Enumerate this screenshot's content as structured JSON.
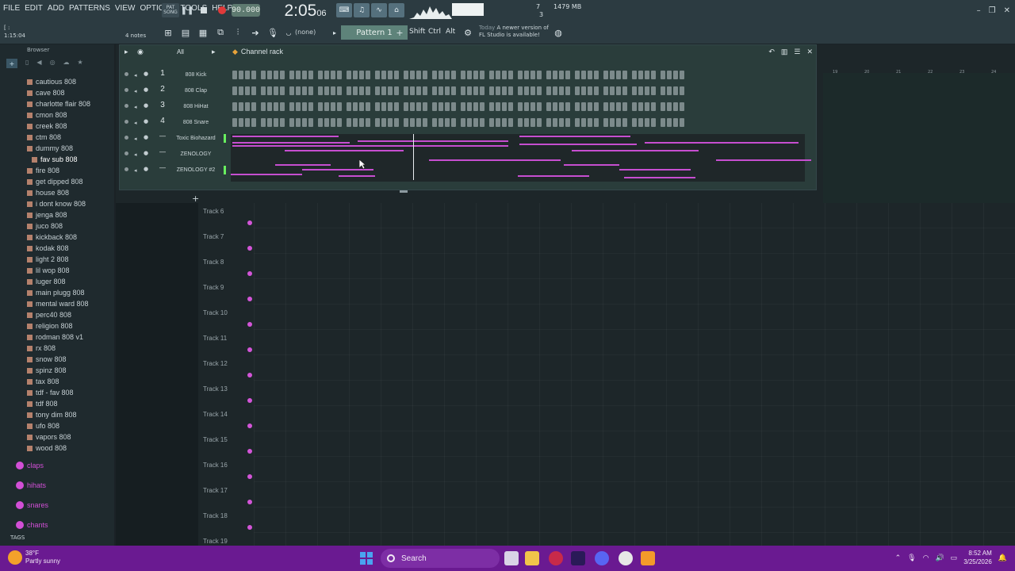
{
  "menu": [
    "FILE",
    "EDIT",
    "ADD",
    "PATTERNS",
    "VIEW",
    "OPTIONS",
    "TOOLS",
    "HELP"
  ],
  "transport": {
    "mode_pat": "PAT",
    "mode_song": "SONG",
    "tempo": "90.000",
    "time_main": "2:05",
    "time_sub": "06"
  },
  "meters": {
    "poly_count": "7",
    "poly_sub": "3",
    "memory": "1479 MB"
  },
  "toolbar2": {
    "position": "1:15:04",
    "notes": "4 notes",
    "none_label": "(none)",
    "pattern": "Pattern 1",
    "keys": [
      "Shift",
      "Ctrl",
      "Alt"
    ],
    "news_day": "Today",
    "news_line1": "A newer version of",
    "news_line2": "FL Studio is available!"
  },
  "browser": {
    "title": "Browser",
    "files": [
      "cautious 808",
      "cave 808",
      "charlotte flair 808",
      "cmon 808",
      "creek 808",
      "ctm 808",
      "dummy 808",
      "fav sub 808",
      "fire 808",
      "get dipped 808",
      "house 808",
      "i dont know 808",
      "jenga 808",
      "juco 808",
      "kickback 808",
      "kodak 808",
      "light 2 808",
      "lil wop 808",
      "luger 808",
      "main plugg 808",
      "mental ward 808",
      "perc40 808",
      "religion 808",
      "rodman 808 v1",
      "rx 808",
      "snow 808",
      "spinz 808",
      "tax 808",
      "tdf - fav 808",
      "tdf 808",
      "tony dim 808",
      "ufo 808",
      "vapors 808",
      "wood 808"
    ],
    "selected_file": "fav sub 808",
    "folders": [
      "claps",
      "hihats",
      "snares",
      "chants"
    ],
    "tags_label": "TAGS"
  },
  "channel_rack": {
    "title": "Channel rack",
    "filter": "All",
    "channels": [
      {
        "num": "1",
        "name": "808 Kick"
      },
      {
        "num": "2",
        "name": "808 Clap"
      },
      {
        "num": "3",
        "name": "808 HiHat"
      },
      {
        "num": "4",
        "name": "808 Snare"
      },
      {
        "num": "",
        "name": "Toxic Biohazard"
      },
      {
        "num": "",
        "name": "ZENOLOGY"
      },
      {
        "num": "",
        "name": "ZENOLOGY #2"
      }
    ]
  },
  "playlist": {
    "tracks": [
      "Track 6",
      "Track 7",
      "Track 8",
      "Track 9",
      "Track 10",
      "Track 11",
      "Track 12",
      "Track 13",
      "Track 14",
      "Track 15",
      "Track 16",
      "Track 17",
      "Track 18",
      "Track 19"
    ],
    "ruler": [
      "19",
      "20",
      "21",
      "22",
      "23",
      "24"
    ]
  },
  "taskbar": {
    "temp": "38°F",
    "weather": "Partly sunny",
    "search": "Search",
    "time": "8:52 AM",
    "date": "3/25/2026"
  },
  "colors": {
    "accent": "#d24fd6",
    "taskbar": "#6a1a91",
    "rack": "#2a3d3b",
    "led": "#68f05f"
  }
}
